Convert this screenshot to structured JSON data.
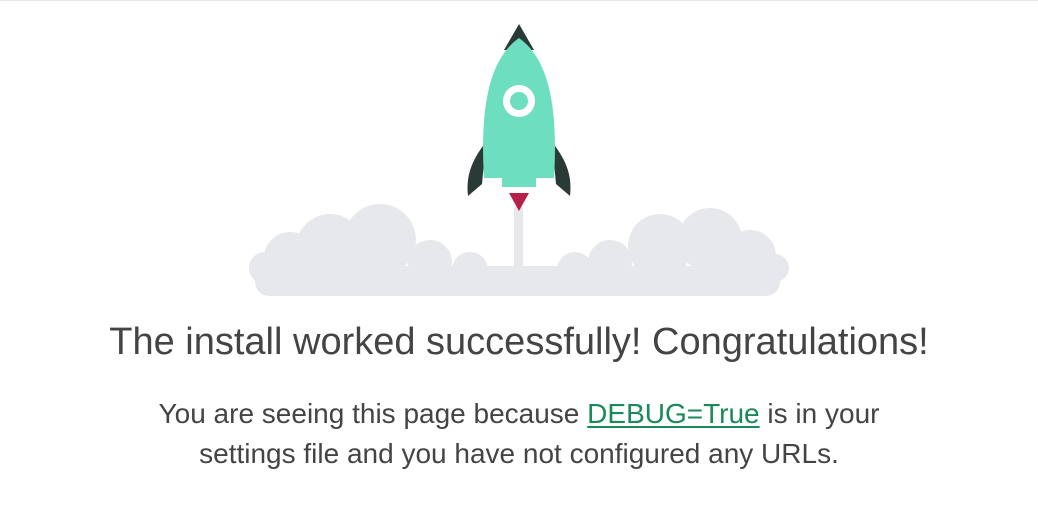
{
  "headline": "The install worked successfully! Congratulations!",
  "message": {
    "before_link": "You are seeing this page because ",
    "link_text": "DEBUG=True",
    "after_link": " is in your settings file and you have not configured any URLs."
  },
  "colors": {
    "rocket_body": "#6ddfc0",
    "rocket_dark": "#2a3a36",
    "flame": "#b5214a",
    "cloud": "#e6e8eb",
    "text": "#444444",
    "link": "#1a8a5a"
  },
  "icons": [
    "rocket-icon",
    "cloud-icon"
  ]
}
